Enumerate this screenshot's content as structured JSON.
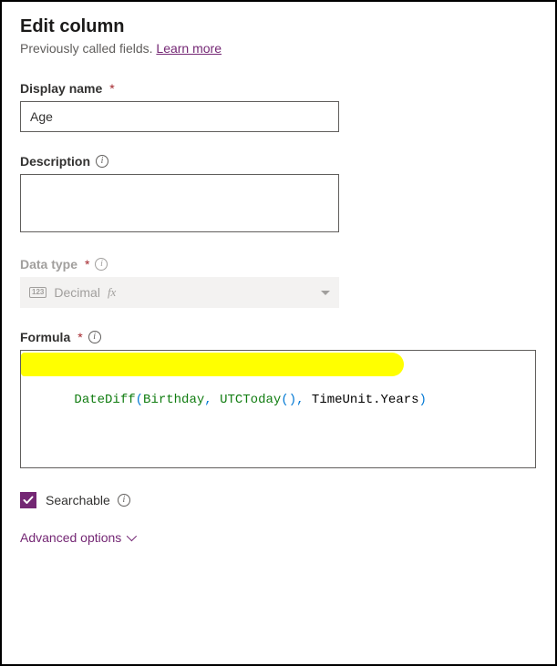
{
  "header": {
    "title": "Edit column",
    "subline_prefix": "Previously called fields. ",
    "learn_more_label": "Learn more"
  },
  "fields": {
    "display_name": {
      "label": "Display name",
      "value": "Age"
    },
    "description": {
      "label": "Description",
      "value": ""
    },
    "data_type": {
      "label": "Data type",
      "selected": "Decimal",
      "icon_text": "123",
      "fx": "fx"
    },
    "formula": {
      "label": "Formula",
      "tokens": {
        "fn1": "DateDiff",
        "open1": "(",
        "arg1": "Birthday",
        "comma1": ", ",
        "fn2": "UTCToday",
        "open2": "(",
        "close2": ")",
        "comma2": ", ",
        "member": "TimeUnit.Years",
        "close1": ")"
      }
    }
  },
  "searchable": {
    "label": "Searchable",
    "checked": true
  },
  "advanced": {
    "label": "Advanced options"
  },
  "colors": {
    "accent": "#742774"
  }
}
